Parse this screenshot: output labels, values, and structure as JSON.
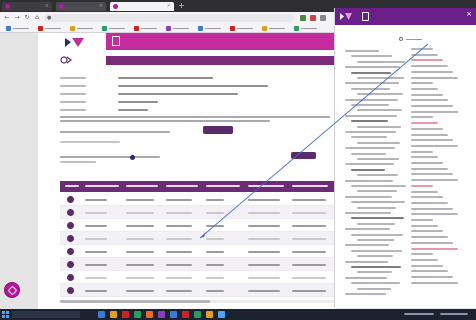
{
  "browser": {
    "tabs": [
      {
        "label": "",
        "active": false
      },
      {
        "label": "",
        "active": false
      },
      {
        "label": "",
        "active": true
      }
    ],
    "address": "",
    "bookmarks": [
      "",
      "",
      "",
      "",
      "",
      "",
      "",
      "",
      "",
      ""
    ]
  },
  "site": {
    "banner_title": "",
    "subtitle": ""
  },
  "form": {
    "fields": [
      {
        "label": "",
        "value": ""
      },
      {
        "label": "",
        "value": ""
      },
      {
        "label": "",
        "value": ""
      },
      {
        "label": "",
        "value": ""
      },
      {
        "label": "",
        "value": ""
      }
    ],
    "search_button": "",
    "export_button": ""
  },
  "table": {
    "columns": [
      "",
      "",
      "",
      "",
      "",
      "",
      "",
      ""
    ],
    "rows": [
      [
        "",
        "",
        "",
        "",
        "",
        "",
        ""
      ],
      [
        "",
        "",
        "",
        "",
        "",
        "",
        ""
      ],
      [
        "",
        "",
        "",
        "",
        "",
        "",
        ""
      ],
      [
        "",
        "",
        "",
        "",
        "",
        "",
        ""
      ],
      [
        "",
        "",
        "",
        "",
        "",
        "",
        ""
      ],
      [
        "",
        "",
        "",
        "",
        "",
        "",
        ""
      ],
      [
        "",
        "",
        "",
        "",
        "",
        "",
        ""
      ],
      [
        "",
        "",
        "",
        "",
        "",
        "",
        ""
      ]
    ]
  },
  "panel": {
    "title": "",
    "search_label": ""
  },
  "taskbar": {
    "search_placeholder": "",
    "clock": ""
  },
  "colors": {
    "brand_magenta": "#c42b9c",
    "brand_purple": "#6b2b75",
    "panel_header": "#6b1f8a",
    "arrow": "#3b6fd6"
  },
  "icons": [
    "app-logo",
    "document-icon",
    "search-icon",
    "close-icon",
    "chat-icon",
    "windows-start-icon"
  ]
}
